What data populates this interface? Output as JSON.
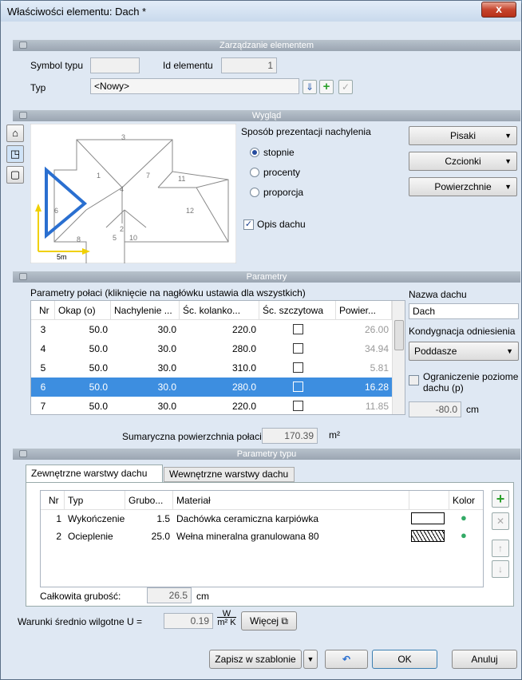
{
  "window": {
    "title": "Właściwości elementu: Dach *",
    "close": "x"
  },
  "mgmt": {
    "header": "Zarządzanie elementem",
    "symbol_label": "Symbol typu",
    "symbol_value": "",
    "id_label": "Id elementu",
    "id_value": "1",
    "typ_label": "Typ",
    "typ_value": "<Nowy>"
  },
  "look": {
    "header": "Wygląd",
    "slope_label": "Sposób prezentacji nachylenia",
    "options": [
      "stopnie",
      "procenty",
      "proporcja"
    ],
    "selected": 0,
    "roof_desc": "Opis dachu",
    "buttons": [
      "Pisaki",
      "Czcionki",
      "Powierzchnie"
    ],
    "plan_numbers": [
      "1",
      "2",
      "3",
      "4",
      "5",
      "6",
      "7",
      "8",
      "10",
      "11",
      "12"
    ],
    "scale": "5m"
  },
  "params": {
    "header": "Parametry",
    "caption": "Parametry połaci (kliknięcie na nagłówku ustawia dla wszystkich)",
    "columns": [
      "Nr",
      "Okap (o)",
      "Nachylenie ...",
      "Śc. kolanko...",
      "Śc. szczytowa",
      "Powier..."
    ],
    "rows": [
      [
        "3",
        "50.0",
        "30.0",
        "220.0",
        "",
        "26.00"
      ],
      [
        "4",
        "50.0",
        "30.0",
        "280.0",
        "",
        "34.94"
      ],
      [
        "5",
        "50.0",
        "30.0",
        "310.0",
        "",
        "5.81"
      ],
      [
        "6",
        "50.0",
        "30.0",
        "280.0",
        "",
        "16.28"
      ],
      [
        "7",
        "50.0",
        "30.0",
        "220.0",
        "",
        "11.85"
      ]
    ],
    "selected_row": 3,
    "sum_label": "Sumaryczna powierzchnia połaci:",
    "sum_value": "170.39",
    "sum_unit": "m²",
    "name_label": "Nazwa dachu",
    "name_value": "Dach",
    "level_label": "Kondygnacja odniesienia",
    "level_value": "Poddasze",
    "limit_label": "Ograniczenie poziome dachu (p)",
    "limit_value": "-80.0",
    "limit_unit": "cm"
  },
  "typeparams": {
    "header": "Parametry typu",
    "tabs": [
      "Zewnętrzne warstwy dachu",
      "Wewnętrzne warstwy dachu"
    ],
    "columns": [
      "Nr",
      "Typ",
      "Grubo...",
      "Materiał",
      "",
      "Kolor"
    ],
    "layers": [
      [
        "1",
        "Wykończenie",
        "1.5",
        "Dachówka ceramiczna karpiówka"
      ],
      [
        "2",
        "Ocieplenie",
        "25.0",
        "Wełna mineralna granulowana 80"
      ]
    ],
    "total_label": "Całkowita grubość:",
    "total_value": "26.5",
    "total_unit": "cm"
  },
  "bottom": {
    "u_label": "Warunki średnio wilgotne U =",
    "u_value": "0.19",
    "u_unit_top": "W",
    "u_unit_bot": "m² K",
    "more": "Więcej",
    "save_tpl": "Zapisz w szablonie",
    "ok": "OK",
    "cancel": "Anuluj"
  }
}
